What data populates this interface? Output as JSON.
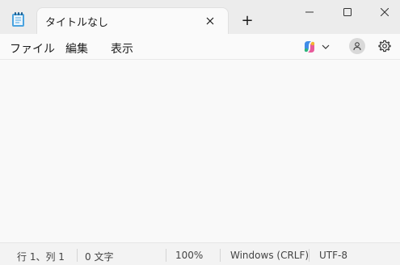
{
  "window": {
    "app_icon": "notepad-icon",
    "tab_title": "タイトルなし",
    "new_tab_glyph": "+",
    "minimize_icon": "minimize-icon",
    "maximize_icon": "maximize-icon",
    "close_icon": "close-icon"
  },
  "menu": {
    "items": [
      "ファイル",
      "編集",
      "表示"
    ],
    "copilot_icon": "copilot-icon",
    "account_icon": "account-icon",
    "settings_icon": "gear-icon"
  },
  "editor": {
    "content": ""
  },
  "status": {
    "position": "行 1、列 1",
    "char_count": "0 文字",
    "zoom": "100%",
    "line_ending": "Windows (CRLF)",
    "encoding": "UTF-8"
  },
  "colors": {
    "titlebar": "#ececec",
    "tab": "#fafafa",
    "editor": "#f9f9f9",
    "statusbar": "#f3f3f3"
  }
}
